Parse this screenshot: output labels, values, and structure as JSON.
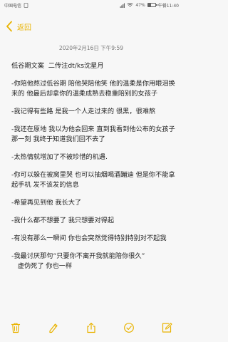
{
  "status_bar": {
    "carrier": "中国电信",
    "battery_percent_label": "47%",
    "battery_level": 0.47,
    "time_label": "午餐11:40"
  },
  "nav": {
    "back_label": "返回"
  },
  "note": {
    "timestamp": "2020年2月16日  下午9:59",
    "lines": [
      "低谷期文案  二传注dt/ks沈星月",
      "",
      "-你陪他熬过低谷期 陪他哭陪他笑 他的温柔是你用眼泪换来的 他最后却拿你的温柔成熟去稳重陪别的女孩子",
      "",
      "-我记得有些路 是我一个人走过来的 很黑，很难熬",
      "",
      "-我还在原地 我以为他会回来 直到我看到他公布的女孩子那一刻 我终于知道我们回不去了",
      "",
      "-太热情就增加了不被珍惜的机遇.",
      "",
      "-你可以躲在被窝里哭 也可以抽烟喝酒蹦迪 但是你不能拿起手机 发不该发的信息",
      "",
      "-希望再见到他 我长大了",
      "",
      "-我什么都不想要了 我只想要对得起",
      "",
      "-有没有那么一瞬间 你也会突然觉得特别特别对不起我",
      "",
      "-我最讨厌那句“只要你不离开我就能陪你很久”",
      "   虚伪死了 你也一样"
    ]
  },
  "toolbar": {
    "icons": [
      "trash-icon",
      "draw-icon",
      "share-icon",
      "checklist-icon",
      "compose-icon"
    ]
  },
  "colors": {
    "accent": "#e9b300",
    "background": "#f7f7f7",
    "text": "#1f1f1f",
    "muted": "#777777"
  }
}
